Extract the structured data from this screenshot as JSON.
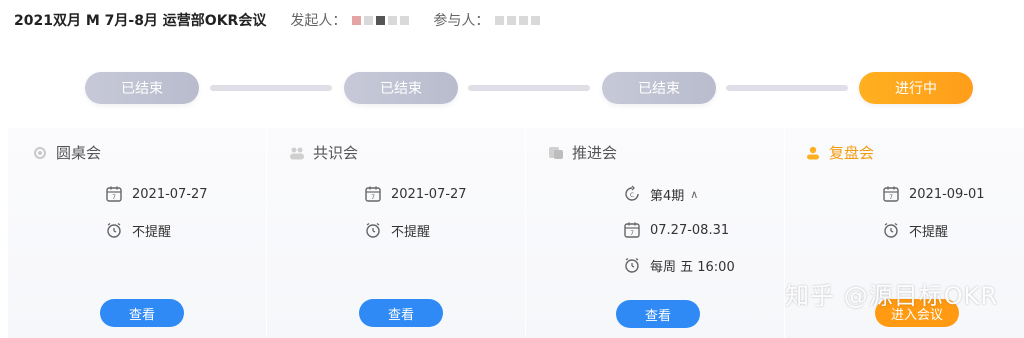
{
  "header": {
    "title": "2021双月  M 7月-8月   运营部OKR会议",
    "initiator_label": "发起人：",
    "participants_label": "参与人："
  },
  "timeline": [
    {
      "label": "已结束",
      "state": "done"
    },
    {
      "label": "已结束",
      "state": "done"
    },
    {
      "label": "已结束",
      "state": "done"
    },
    {
      "label": "进行中",
      "state": "active"
    }
  ],
  "columns": [
    {
      "title": "圆桌会",
      "icon": "roundtable-icon",
      "date": "2021-07-27",
      "reminder": "不提醒",
      "button": "查看"
    },
    {
      "title": "共识会",
      "icon": "consensus-icon",
      "date": "2021-07-27",
      "reminder": "不提醒",
      "button": "查看"
    },
    {
      "title": "推进会",
      "icon": "progress-icon",
      "period": "第4期",
      "date_range": "07.27-08.31",
      "schedule": "每周 五 16:00",
      "button": "查看"
    },
    {
      "title": "复盘会",
      "icon": "review-icon",
      "date": "2021-09-01",
      "reminder": "不提醒",
      "button": "进入会议"
    }
  ],
  "watermark": "知乎 @源目标OKR",
  "colors": {
    "blue": "#2f8af5",
    "orange": "#ff9a12",
    "done_pill": "#c0c2d2"
  }
}
